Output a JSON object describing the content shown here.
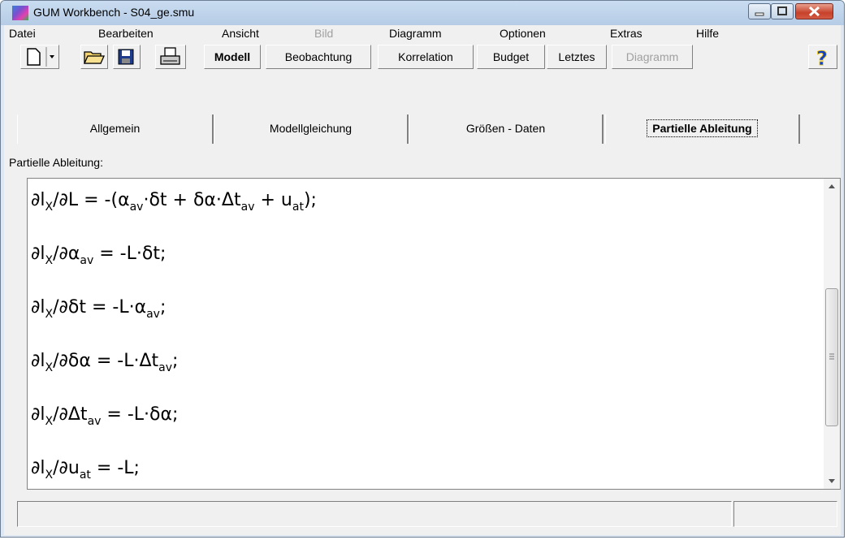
{
  "window": {
    "title": "GUM Workbench - S04_ge.smu"
  },
  "menu": [
    {
      "label": "Datei",
      "enabled": true
    },
    {
      "label": "Bearbeiten",
      "enabled": true
    },
    {
      "label": "Ansicht",
      "enabled": true
    },
    {
      "label": "Bild",
      "enabled": false
    },
    {
      "label": "Diagramm",
      "enabled": true
    },
    {
      "label": "Optionen",
      "enabled": true
    },
    {
      "label": "Extras",
      "enabled": true
    },
    {
      "label": "Hilfe",
      "enabled": true
    }
  ],
  "toolbar": {
    "icons": [
      "new-file-icon",
      "dropdown-arrow-icon",
      "open-folder-icon",
      "save-disk-icon",
      "print-icon",
      "help-icon"
    ],
    "buttons": [
      {
        "label": "Modell",
        "bold": true,
        "enabled": true
      },
      {
        "label": "Beobachtung",
        "enabled": true
      },
      {
        "label": "Korrelation",
        "enabled": true
      },
      {
        "label": "Budget",
        "enabled": true
      },
      {
        "label": "Letztes",
        "enabled": true
      },
      {
        "label": "Diagramm",
        "enabled": false
      }
    ],
    "help_label": "?"
  },
  "tabs": [
    {
      "label": "Allgemein",
      "accel": "A",
      "active": false
    },
    {
      "label": "Modellgleichung",
      "accel": "M",
      "active": false
    },
    {
      "label": "Größen - Daten",
      "accel": "G",
      "active": false
    },
    {
      "label": "Partielle Ableitung",
      "accel": "P",
      "active": true
    }
  ],
  "content": {
    "section_label": "Partielle Ableitung:",
    "formulas": [
      "∂l_{X}/∂L = -(α_{av}·δt + δα·Δt_{av} + u_{at});",
      "∂l_{X}/∂α_{av} = -L·δt;",
      "∂l_{X}/∂δt = -L·α_{av};",
      "∂l_{X}/∂δα = -L·Δt_{av};",
      "∂l_{X}/∂Δt_{av} = -L·δα;",
      "∂l_{X}/∂u_{at} = -L;"
    ]
  },
  "scrollbar": {
    "position": "middle"
  },
  "statusbar": {
    "panes": [
      "",
      ""
    ]
  }
}
